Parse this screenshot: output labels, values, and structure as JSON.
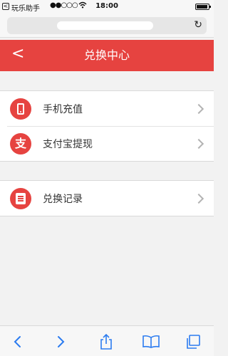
{
  "status_bar": {
    "back_app_glyph": "<",
    "app_name": "玩乐助手",
    "signal": "●●○○○",
    "time": "18:00"
  },
  "browser": {
    "reload_glyph": "↻"
  },
  "header": {
    "back_glyph": "<",
    "title": "兑换中心"
  },
  "menu": {
    "section1": [
      {
        "label": "手机充值",
        "icon": "phone-icon"
      },
      {
        "label": "支付宝提现",
        "icon": "alipay-icon"
      }
    ],
    "section2": [
      {
        "label": "兑换记录",
        "icon": "record-icon"
      }
    ]
  },
  "toolbar": {
    "back_glyph": "<",
    "forward_glyph": ">"
  },
  "colors": {
    "accent": "#e64340",
    "ios_blue": "#2b7bf0"
  }
}
